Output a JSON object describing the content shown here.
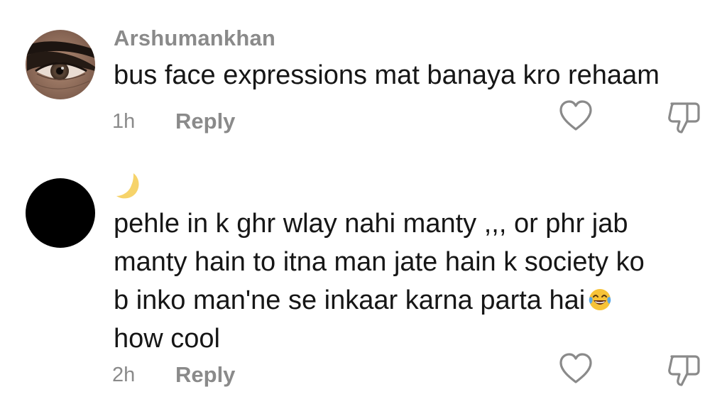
{
  "comments": [
    {
      "username": "Arshumankhan",
      "avatar": "eye-closeup-avatar",
      "text": "bus face expressions mat banaya kro rehaam",
      "time": "1h",
      "reply_label": "Reply",
      "icons": {
        "like": "heart-icon",
        "dislike": "thumbs-down-icon"
      }
    },
    {
      "username_icon": "crescent-moon-icon",
      "avatar": "black-avatar",
      "text_lines": [
        "pehle in k ghr wlay nahi manty ,,, or phr jab",
        "manty hain to itna man jate hain k society ko",
        "b inko man'ne se inkaar karna parta hai",
        "how cool"
      ],
      "emoji": "face-with-tears-of-joy-emoji",
      "time": "2h",
      "reply_label": "Reply",
      "icons": {
        "like": "heart-icon",
        "dislike": "thumbs-down-icon"
      }
    }
  ],
  "colors": {
    "text": "#161616",
    "meta": "#8a8a8a",
    "moon": "#f6d36a",
    "emoji_face": "#f7c338",
    "emoji_tears": "#5aa8e8"
  }
}
